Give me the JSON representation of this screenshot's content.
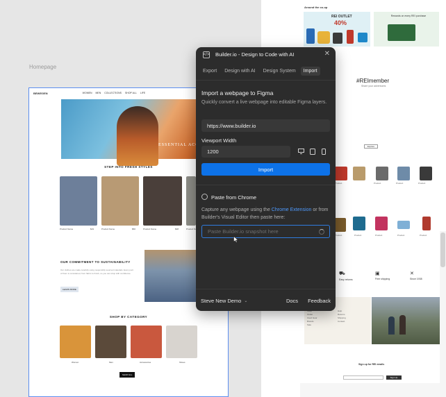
{
  "canvas": {
    "frame_label": "Homepage"
  },
  "homepage": {
    "nav": {
      "logo": "BEWEGEN",
      "links": [
        "WOMEN",
        "MEN",
        "COLLECTIONS",
        "SHOP ALL",
        "LIFE"
      ],
      "cta": "SIGN UP"
    },
    "hero": {
      "title": "ESSENTIAL ACCESSORIES",
      "button": "SHOP NOW"
    },
    "fresh_styles": {
      "title": "STEP INTO FRESH STYLES",
      "items": [
        {
          "name": "Product Name",
          "price": "$19",
          "color": "#6d7f9a"
        },
        {
          "name": "Product Name",
          "price": "$50",
          "color": "#b89a74"
        },
        {
          "name": "Product Name",
          "price": "$38",
          "color": "#4a3f3a"
        },
        {
          "name": "Product Name",
          "price": "$9",
          "color": "#8c8c86"
        }
      ]
    },
    "sustainability": {
      "title": "OUR COMMITMENT TO SUSTAINABILITY",
      "text": "Our clothes are made carefully using responsibly sourced materials. Every part of them is considered, from fabric to finish, so you can shop with confidence.",
      "button": "LEARN MORE"
    },
    "category": {
      "title": "SHOP BY CATEGORY",
      "items": [
        {
          "name": "Women",
          "color": "#d9943a"
        },
        {
          "name": "Men",
          "color": "#5b4a3a"
        },
        {
          "name": "Accessories",
          "color": "#c9583e"
        },
        {
          "name": "Shoes",
          "color": "#d8d4cf"
        }
      ],
      "button": "SHOP ALL"
    }
  },
  "webpage": {
    "around_title": "Around the co-op",
    "promo1": {
      "title": "REI OUTLET",
      "discount": "40%"
    },
    "promo2": {
      "text": "Rewards on every REI purchase"
    },
    "remember_title": "#REImember",
    "remember_sub": "Share your adventures",
    "button": "Explore",
    "products_row1": [
      "Product",
      "Product",
      "Product",
      "Product",
      "Product"
    ],
    "products_row2": [
      "Product",
      "Product",
      "Product",
      "Product",
      "Product"
    ],
    "services": [
      {
        "icon": "truck-icon",
        "label": "Easy returns"
      },
      {
        "icon": "box-icon",
        "label": "Free shipping"
      },
      {
        "icon": "tool-icon",
        "label": "Since 1938"
      }
    ],
    "footer_cols": [
      [
        "Shop",
        "Outlet",
        "Used Gear",
        "Brands",
        "Sale"
      ],
      [
        "Help",
        "Returns",
        "Shipping",
        "Contact"
      ]
    ],
    "signup": {
      "title": "Sign up for REI emails",
      "button": "Sign Up"
    }
  },
  "dialog": {
    "title": "Builder.io - Design to Code with AI",
    "tabs": [
      {
        "label": "Export",
        "active": false
      },
      {
        "label": "Design with AI",
        "active": false
      },
      {
        "label": "Design System",
        "active": false
      },
      {
        "label": "Import",
        "active": true
      }
    ],
    "import": {
      "heading": "Import a webpage to Figma",
      "description": "Quickly convert a live webpage into editable Figma layers.",
      "url_value": "https://www.builder.io",
      "viewport_label": "Viewport Width",
      "viewport_value": "1200",
      "import_button": "Import"
    },
    "paste": {
      "heading": "Paste from Chrome",
      "desc_pre": "Capture any webpage using the ",
      "desc_link": "Chrome Extension",
      "desc_post": " or from Builder's Visual Editor then paste here:",
      "placeholder": "Paste Builder.io snapshot here"
    },
    "footer": {
      "user": "Steve New Demo",
      "docs": "Docs",
      "feedback": "Feedback"
    }
  }
}
